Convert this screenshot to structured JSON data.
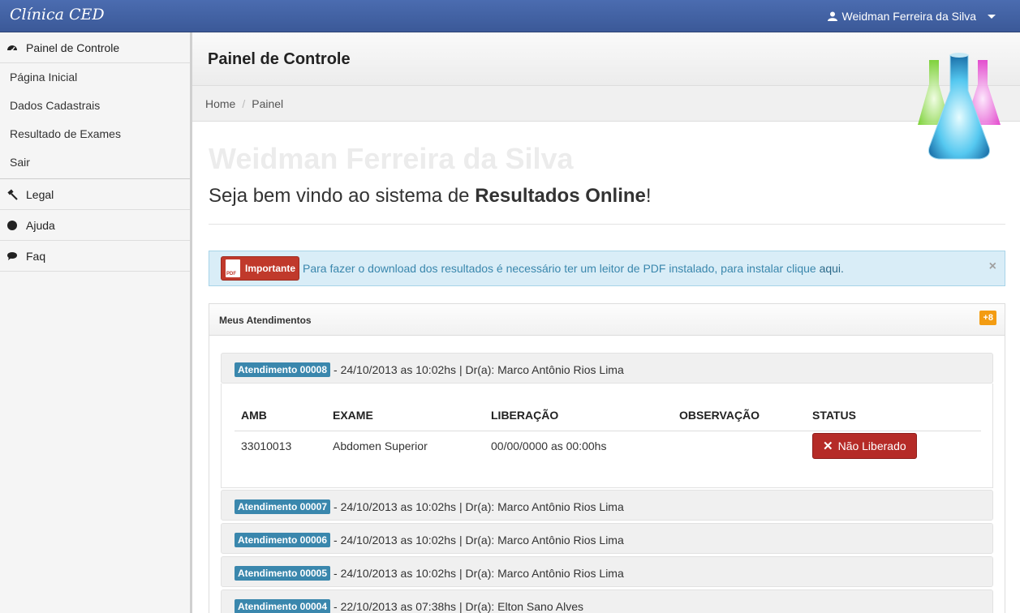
{
  "app": {
    "brand": "Clínica CED",
    "user_name": "Weidman Ferreira da Silva"
  },
  "sidebar": {
    "sections": [
      {
        "label": "Painel de Controle",
        "icon": "dashboard-icon"
      },
      {
        "label": "Legal",
        "icon": "gavel-icon"
      },
      {
        "label": "Ajuda",
        "icon": "question-circle-icon"
      },
      {
        "label": "Faq",
        "icon": "comment-icon"
      }
    ],
    "links": [
      "Página Inicial",
      "Dados Cadastrais",
      "Resultado de Exames",
      "Sair"
    ]
  },
  "header": {
    "title": "Painel de Controle"
  },
  "breadcrumb": {
    "home": "Home",
    "current": "Painel"
  },
  "welcome": {
    "name": "Weidman Ferreira da Silva",
    "prefix": "Seja bem vindo ao sistema de ",
    "bold": "Resultados Online",
    "suffix": "!"
  },
  "alert": {
    "badge": "Importante",
    "message": "Para fazer o download dos resultados é necessário ter um leitor de PDF instalado, para instalar clique",
    "link": "aqui.",
    "close": "×"
  },
  "panel": {
    "title": "Meus Atendimentos",
    "count": "+8",
    "items": [
      {
        "label": "Atendimento 00008",
        "detail": "- 24/10/2013 as 10:02hs | Dr(a): Marco Antônio Rios Lima"
      },
      {
        "label": "Atendimento 00007",
        "detail": "- 24/10/2013 as 10:02hs | Dr(a): Marco Antônio Rios Lima"
      },
      {
        "label": "Atendimento 00006",
        "detail": "- 24/10/2013 as 10:02hs | Dr(a): Marco Antônio Rios Lima"
      },
      {
        "label": "Atendimento 00005",
        "detail": "- 24/10/2013 as 10:02hs | Dr(a): Marco Antônio Rios Lima"
      },
      {
        "label": "Atendimento 00004",
        "detail": "- 22/10/2013 as 07:38hs | Dr(a): Elton Sano Alves"
      }
    ],
    "table": {
      "headers": [
        "AMB",
        "EXAME",
        "LIBERAÇÃO",
        "OBSERVAÇÃO",
        "STATUS"
      ],
      "row": {
        "amb": "33010013",
        "exame": "Abdomen Superior",
        "liberacao": "00/00/0000 as 00:00hs",
        "observacao": "",
        "status": "Não Liberado"
      }
    }
  },
  "colors": {
    "topbar": "#3b5998",
    "label": "#3a87ad",
    "danger": "#b52b27",
    "warning": "#f39c12",
    "alert_bg": "#d9edf7"
  }
}
